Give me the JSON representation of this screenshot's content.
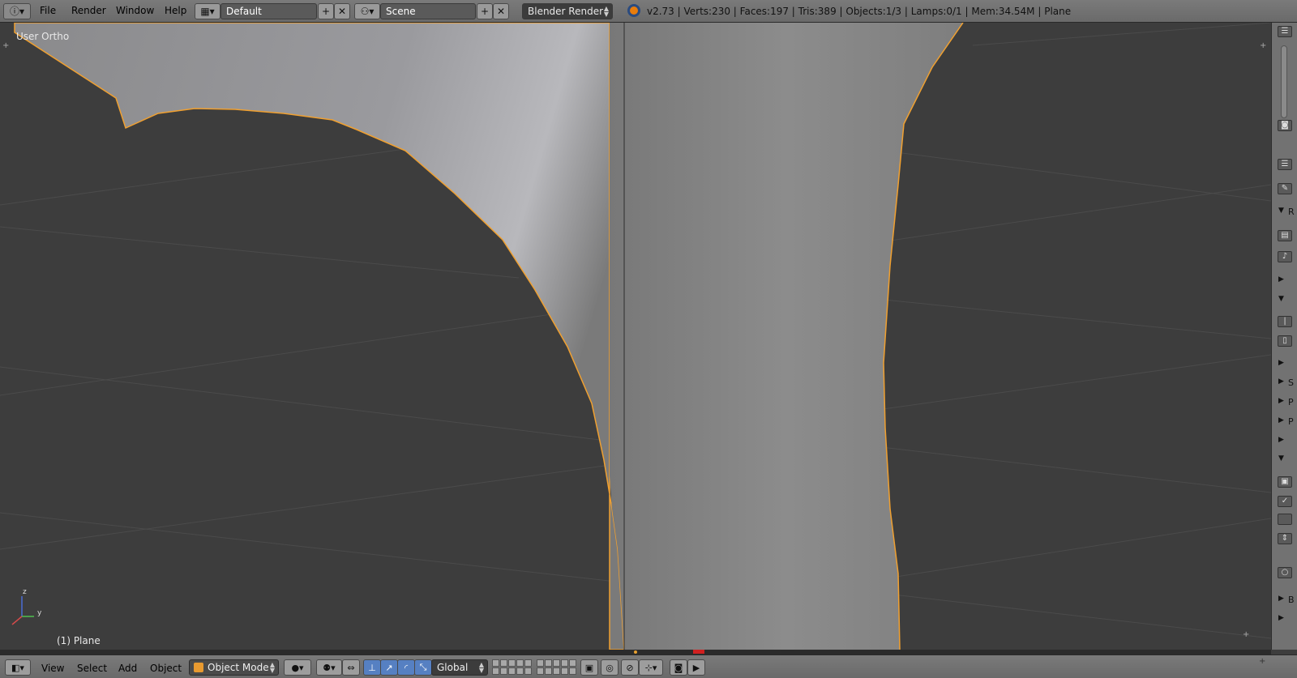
{
  "topbar": {
    "menus": [
      "File",
      "Render",
      "Window",
      "Help"
    ],
    "layout": "Default",
    "scene": "Scene",
    "engine": "Blender Render",
    "stats": "v2.73 | Verts:230 | Faces:197 | Tris:389 | Objects:1/3 | Lamps:0/1 | Mem:34.54M | Plane",
    "icons": [
      "info-icon",
      "screen-layout-icon",
      "add-icon",
      "close-icon",
      "scene-icon",
      "blender-logo-icon"
    ]
  },
  "viewport": {
    "view_label": "User Ortho",
    "object_label": "(1) Plane",
    "axes": {
      "z": "z",
      "y": "y"
    },
    "colors": {
      "background": "#3d3d3d",
      "mesh_outline": "#f0a030",
      "grid": "#4a4a4a"
    }
  },
  "sidepanel": {
    "letters": [
      "R",
      "S",
      "P",
      "P",
      "B"
    ]
  },
  "bottombar": {
    "menus": [
      "View",
      "Select",
      "Add",
      "Object"
    ],
    "mode": "Object Mode",
    "orientation": "Global",
    "icons": [
      "editor-type-icon",
      "object-mode-icon",
      "shading-solid-icon",
      "pivot-icon",
      "manipulator-icon",
      "translate-icon",
      "rotate-icon",
      "scale-icon",
      "layers-icon",
      "render-icon",
      "camera-icon"
    ]
  }
}
